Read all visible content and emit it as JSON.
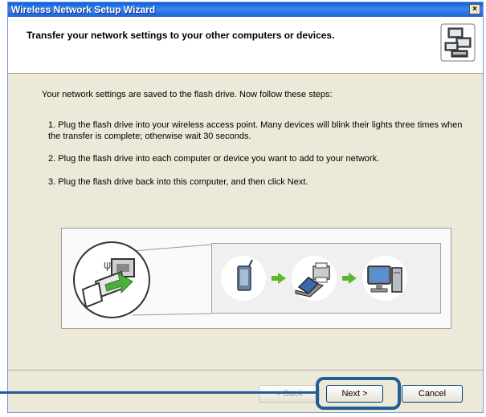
{
  "window": {
    "title": "Wireless Network Setup Wizard",
    "close_label": "×"
  },
  "header": {
    "title": "Transfer your network settings to your other computers or devices.",
    "icon": "network-computers-icon"
  },
  "content": {
    "intro": "Your network settings are saved to the flash drive. Now follow these steps:",
    "steps": [
      "1. Plug the flash drive into your wireless access point. Many devices will blink their lights three times when the transfer is complete; otherwise wait 30 seconds.",
      "2. Plug the flash drive into each computer or device you want to add to your network.",
      "3. Plug the flash drive back into this computer, and then click Next."
    ],
    "illustration": {
      "icons": [
        "usb-plug-icon",
        "access-point-icon",
        "arrow-right-icon",
        "laptop-printer-icon",
        "arrow-right-icon",
        "desktop-computer-icon"
      ]
    }
  },
  "buttons": {
    "back": "< Back",
    "next": "Next >",
    "cancel": "Cancel"
  },
  "colors": {
    "titlebar": "#0a5fd6",
    "window_bg": "#ece9d8",
    "highlight": "#1f5e96",
    "arrow": "#5cb82a"
  }
}
